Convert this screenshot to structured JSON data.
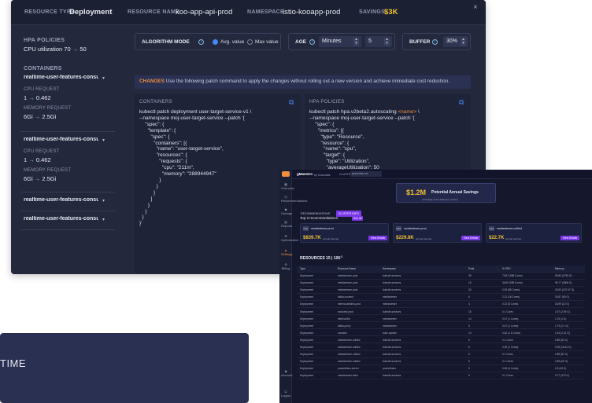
{
  "top_bar": {
    "resource_type_label": "RESOURCE TYPE",
    "resource_type_value": "Deployment",
    "resource_name_label": "RESOURCE NAME",
    "resource_name_value": "koo-app-api-prod",
    "namespace_label": "NAMESPACE",
    "namespace_value": "istio-kooapp-prod",
    "savings_label": "SAVINGS",
    "savings_value": "$3K",
    "close_icon": "×"
  },
  "left": {
    "hpa_title": "HPA POLICIES",
    "hpa_text_prefix": "CPU utilization",
    "hpa_from": "70",
    "hpa_to": "50",
    "containers_title": "CONTAINERS",
    "containers": [
      {
        "name": "realtime-user-features-consu...",
        "cpu_label": "CPU REQUEST",
        "cpu_from": "1",
        "cpu_to": "0.462",
        "mem_label": "MEMORY REQUEST",
        "mem_from": "6Gi",
        "mem_to": "2.5Gi"
      },
      {
        "name": "realtime-user-features-consu...",
        "cpu_label": "CPU REQUEST",
        "cpu_from": "1",
        "cpu_to": "0.462",
        "mem_label": "MEMORY REQUEST",
        "mem_from": "6Gi",
        "mem_to": "2.5Gi"
      },
      {
        "name": "realtime-user-features-consu..."
      },
      {
        "name": "realtime-user-features-consu..."
      }
    ],
    "arrow": "→"
  },
  "controls": {
    "algorithm_label": "ALGORITHM MODE",
    "avg_label": "Avg. value",
    "max_label": "Max value",
    "age_label": "AGE",
    "age_unit": "Minutes",
    "age_value": "5",
    "buffer_label": "BUFFER",
    "buffer_value": "30%"
  },
  "changes": {
    "label": "CHANGES",
    "text": "Use the following patch command to apply the changes without rolling out a new version and achieve immediate cost reduction."
  },
  "code": {
    "containers_title": "CONTAINERS",
    "containers_code": "kubectl patch deployment user-target-service-v1 \\\n--namespace moj-user-target-service --patch '{\n    \"spec\": {\n      \"template\": {\n        \"spec\": {\n          \"containers\": [{\n            \"name\": \"user-target-service\",\n            \"resources\": {\n              \"requests\": {\n                \"cpu\": \"211m\",\n                \"memory\": \"288944947\"\n              }\n            }\n          }\n        ]\n      }\n    }\n  }\n}'",
    "hpa_title": "HPA POLICIES",
    "hpa_code_line1": "kubectl patch hpa.v2beta2.autoscaling ",
    "hpa_code_hl": "<name>",
    "hpa_code_line1_end": " \\",
    "hpa_code_rest": "--namespace moj-user-target-service --patch '{\n    \"spec\": {\n      \"metrics\": [{\n        \"type\": \"Resource\",\n        \"resource\": {\n          \"name\": \"cpu\",\n          \"target\": {\n            \"type\": \"Utilization\",\n            \"averageUtilization\": 50"
  },
  "bottom_card": {
    "text": "TIME"
  },
  "app": {
    "brand": "gMaestro",
    "brand_sub": "by Granulate",
    "cluster_label": "CLUSTER",
    "cluster_value": "granulate-ws",
    "sidebar": [
      "Overview",
      "Recommendations",
      "Savings",
      "Reports",
      "Optimization",
      "Settings",
      "Billing",
      "Account",
      "Logout"
    ],
    "savings_amount": "$1.2M",
    "savings_label": "Potential Annual Savings",
    "savings_sub": "According to the datasets you'll be",
    "tabs": [
      "RECOMMENDATIONS",
      "CLUSTER INFO"
    ],
    "top3_title": "Top 3 recommendations",
    "top3_badge": "See all",
    "recs": [
      {
        "icon": "DEP",
        "name": "mediaviewer-prod",
        "amount": "$839.7K",
        "unit": "annual savings",
        "button": "View Details"
      },
      {
        "icon": "DEP",
        "name": "mediaviewer-prod",
        "amount": "$229.8K",
        "unit": "annual savings",
        "button": "View Details"
      },
      {
        "icon": "DEP",
        "name": "mediaviewer-unified",
        "amount": "$22.7K",
        "unit": "annual savings",
        "button": "View Details"
      }
    ],
    "resources_title": "RESOURCES 15 | 106",
    "columns": [
      "Type",
      "Resource Name",
      "Namespace",
      "Pods",
      "% CPU",
      "Memory"
    ],
    "rows": [
      [
        "Deployment",
        "mediaviewer-prod",
        "kubedb-services",
        "35",
        "79.87 (985 Cores)",
        "96.89 (2795 G)"
      ],
      [
        "Deployment",
        "mediaviewer-prod",
        "kubedb-services",
        "15",
        "36.80 (985 Cores)",
        "96.77 (3808 G)"
      ],
      [
        "Deployment",
        "mediaviewer-prod",
        "kubedb-services",
        "20",
        "0.92 (85 Cores)",
        "26.53 (157.97 G)"
      ],
      [
        "Deployment",
        "kafka-connect",
        "mediaviewer",
        "6",
        "2.12 (16 Cores)",
        "16.87 (90 G)"
      ],
      [
        "Deployment",
        "internal-articles-prod",
        "mediaviewer",
        "4",
        "0.12 (8 Cores)",
        "18.99 (12 G)"
      ],
      [
        "Deployment",
        "mounted-prod",
        "kubedb-services",
        "15",
        "0.1 Cores",
        "2.57 (2.95 G)"
      ],
      [
        "Deployment",
        "internal-fire",
        "mediaviewer",
        "10",
        "0.47 (1 Cores)",
        "1.76 (1 G)"
      ],
      [
        "Deployment",
        "kafka-proxy",
        "mediaviewer",
        "5",
        "0.47 (1 Cores)",
        "1.73 (2.1 G)"
      ],
      [
        "Deployment",
        "consider",
        "kube-system",
        "10",
        "0.62 (1.9 Cores)",
        "1.44 (2.31 G)"
      ],
      [
        "Deployment",
        "mediaviewer-unified",
        "kubedb-services",
        "5",
        "0.1 Cores",
        "0.89 (82 G)"
      ],
      [
        "Deployment",
        "mediaviewer-unified",
        "kubedb-services",
        "5",
        "0.25 (1 Cores)",
        "0.99 (16.42 G)"
      ],
      [
        "Deployment",
        "mediaviewer-unified",
        "kubedb-services",
        "5",
        "0.1 Cores",
        "0.89 (82 G)"
      ],
      [
        "Deployment",
        "mediaviewer-unified",
        "kubedb-services",
        "5",
        "0.1 Cores",
        "0.89 (62 G)"
      ],
      [
        "Deployment",
        "prometheus-server",
        "prometheus",
        "5",
        "0.55 (4 Cores)",
        "2.8 (43 G)"
      ],
      [
        "Deployment",
        "mediaviewer-fetch",
        "kubedb-services",
        "5",
        "0.1 Cores",
        "0.77 (375 G)"
      ]
    ]
  }
}
